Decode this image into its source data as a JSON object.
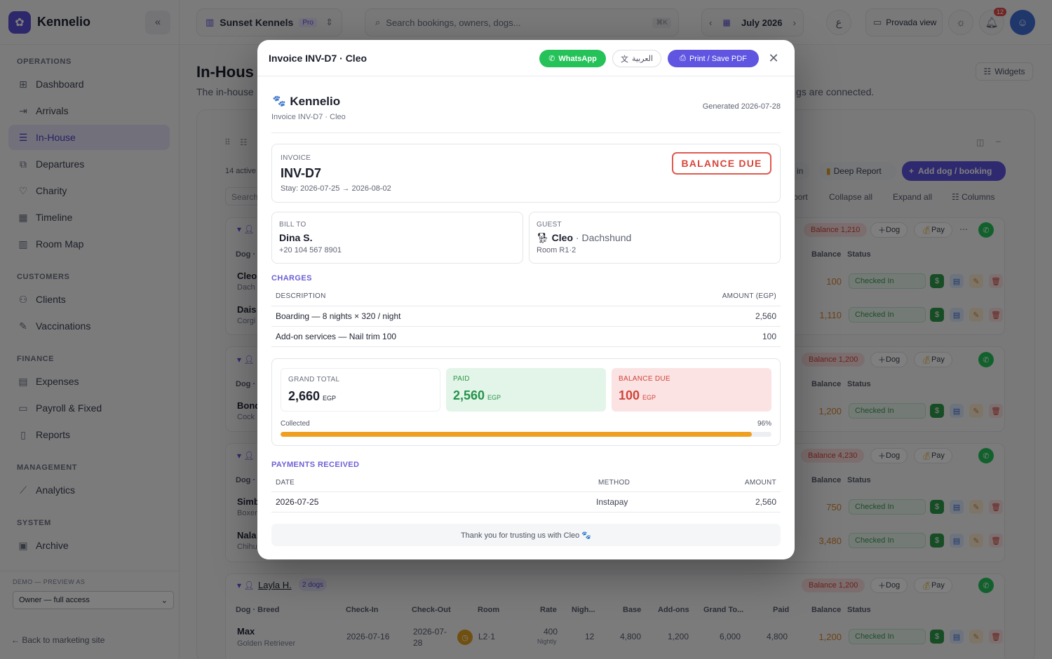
{
  "sidebar": {
    "brand": "Kennelio",
    "sections": {
      "operations": "OPERATIONS",
      "customers": "CUSTOMERS",
      "finance": "FINANCE",
      "management": "MANAGEMENT",
      "system": "SYSTEM"
    },
    "items": {
      "dashboard": "Dashboard",
      "arrivals": "Arrivals",
      "inhouse": "In-House",
      "departures": "Departures",
      "charity": "Charity",
      "timeline": "Timeline",
      "roommap": "Room Map",
      "clients": "Clients",
      "vaccinations": "Vaccinations",
      "expenses": "Expenses",
      "payroll": "Payroll & Fixed",
      "reports": "Reports",
      "analytics": "Analytics",
      "archive": "Archive"
    },
    "preview_label": "DEMO — PREVIEW AS",
    "preview_value": "Owner — full access",
    "back_link": "← Back to marketing site"
  },
  "topbar": {
    "kennel_name": "Sunset Kennels",
    "kennel_plan": "Pro",
    "search_placeholder": "Search bookings, owners, dogs...",
    "search_shortcut": "⌘K",
    "month": "July 2026",
    "lang_short": "ع",
    "view_label": "Provada view",
    "notifications_count": "12"
  },
  "background": {
    "title": "In-Hous",
    "subtitle": "The in-house",
    "subtitle_tail": "gs are connected.",
    "widgets": "Widgets",
    "active_count": "14 active",
    "search_stub": "Search",
    "deep_report": "Deep Report",
    "add_dog": "Add dog / booking",
    "in_stub": "in",
    "export_stub": "port",
    "collapse_all": "Collapse all",
    "expand_all": "Expand all",
    "columns": "Columns",
    "dog_col": "Dog ·",
    "dog_breed_col": "Dog · Breed",
    "balance_col": "Balance",
    "status_col": "Status",
    "checkin_col": "Check-In",
    "checkout_col": "Check-Out",
    "room_col": "Room",
    "rate_col": "Rate",
    "nights_col": "Nigh...",
    "base_col": "Base",
    "addons_col": "Add-ons",
    "grand_col": "Grand To...",
    "paid_col": "Paid",
    "checked_in": "Checked In",
    "dog_btn": "Dog",
    "pay_btn": "Pay",
    "group1_balance": "Balance 1,210",
    "group2_balance": "Balance 1,200",
    "group3_balance": "Balance 4,230",
    "group4_balance": "Balance 1,200",
    "group4_owner": "Layla H.",
    "group4_dogs": "2 dogs",
    "rows": {
      "r1_name": "Cleo",
      "r1_breed": "Dach",
      "r1_bal": "100",
      "r2_name": "Dais",
      "r2_breed": "Corgi",
      "r2_bal": "1,110",
      "r3_name": "Bond",
      "r3_breed": "Cock",
      "r3_bal": "1,200",
      "r4_name": "Simb",
      "r4_breed": "Boxer",
      "r4_bal": "750",
      "r5_name": "Nala",
      "r5_breed": "Chihu",
      "r5_bal": "3,480"
    },
    "max_row": {
      "name": "Max",
      "breed": "Golden Retriever",
      "checkin": "2026-07-16",
      "checkout_1": "2026-07-",
      "checkout_2": "28",
      "room": "L2·1",
      "rate": "400",
      "rate_unit": "Nightly",
      "nights": "12",
      "base": "4,800",
      "addons": "1,200",
      "grand": "6,000",
      "paid": "4,800",
      "balance": "1,200"
    }
  },
  "modal": {
    "title": "Invoice INV-D7 · Cleo",
    "whatsapp": "WhatsApp",
    "arabic": "العربية",
    "print": "Print / Save PDF",
    "brand": "Kennelio",
    "brand_sub": "Invoice INV-D7 · Cleo",
    "generated": "Generated 2026-07-28",
    "invoice_cap": "INVOICE",
    "invoice_no": "INV-D7",
    "stay": "Stay: 2026-07-25 → 2026-08-02",
    "status_badge": "BALANCE DUE",
    "bill_to_cap": "BILL TO",
    "bill_to_name": "Dina S.",
    "bill_to_phone": "+20 104 567 8901",
    "guest_cap": "GUEST",
    "guest_name": "Cleo",
    "guest_breed": "· Dachshund",
    "guest_room": "Room R1·2",
    "charges_title": "CHARGES",
    "charges_cols": {
      "desc": "DESCRIPTION",
      "amount": "AMOUNT (EGP)"
    },
    "charges": [
      {
        "desc": "Boarding — 8 nights × 320 / night",
        "amount": "2,560"
      },
      {
        "desc": "Add-on services — Nail trim 100",
        "amount": "100"
      }
    ],
    "totals": {
      "grand_cap": "GRAND TOTAL",
      "grand": "2,660",
      "paid_cap": "PAID",
      "paid": "2,560",
      "due_cap": "BALANCE DUE",
      "due": "100",
      "currency": "EGP"
    },
    "collected_label": "Collected",
    "collected_pct": "96%",
    "collected_fraction": 0.96,
    "payments_title": "PAYMENTS RECEIVED",
    "payments_cols": {
      "date": "DATE",
      "method": "METHOD",
      "amount": "AMOUNT"
    },
    "payments": [
      {
        "date": "2026-07-25",
        "method": "Instapay",
        "amount": "2,560"
      }
    ],
    "thanks": "Thank you for trusting us with Cleo 🐾"
  }
}
